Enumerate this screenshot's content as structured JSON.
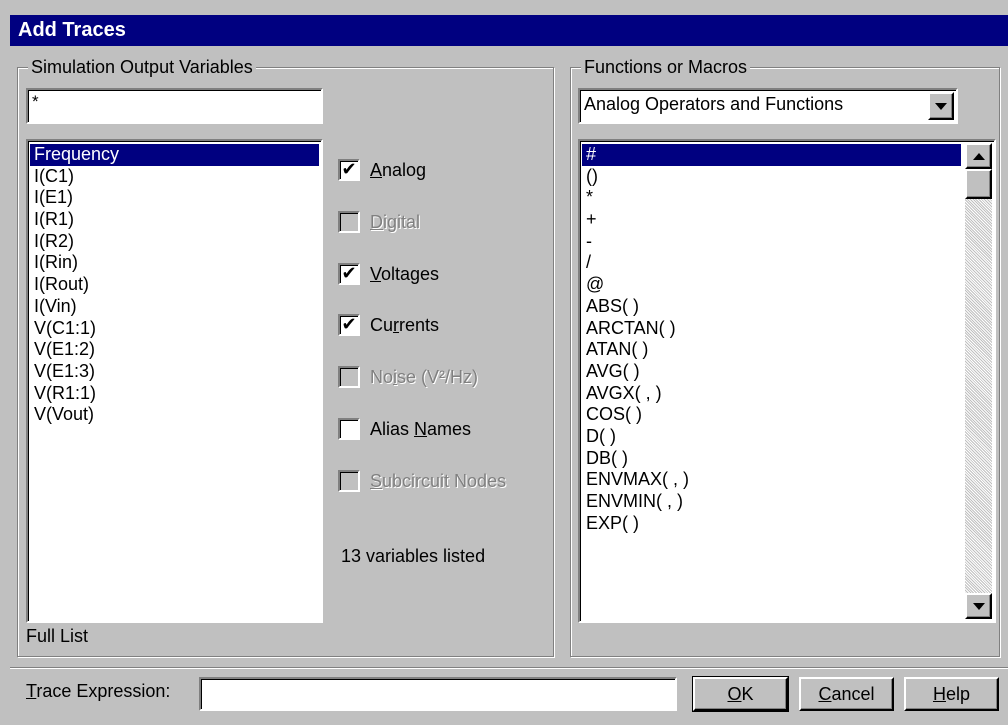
{
  "dialog": {
    "title": "Add Traces"
  },
  "left_group": {
    "title": "Simulation Output Variables",
    "filter_value": "*",
    "variables": [
      "Frequency",
      "I(C1)",
      "I(E1)",
      "I(R1)",
      "I(R2)",
      "I(Rin)",
      "I(Rout)",
      "I(Vin)",
      "V(C1:1)",
      "V(E1:2)",
      "V(E1:3)",
      "V(R1:1)",
      "V(Vout)"
    ],
    "selected_variable": "Frequency",
    "list_label": "Full List",
    "count_text": "13 variables listed"
  },
  "filters": [
    {
      "key": "analog",
      "pre": "",
      "hot": "A",
      "post": "nalog",
      "checked": true,
      "enabled": true
    },
    {
      "key": "digital",
      "pre": "",
      "hot": "D",
      "post": "igital",
      "checked": false,
      "enabled": false
    },
    {
      "key": "voltages",
      "pre": "",
      "hot": "V",
      "post": "oltages",
      "checked": true,
      "enabled": true
    },
    {
      "key": "currents",
      "pre": "Cu",
      "hot": "r",
      "post": "rents",
      "checked": true,
      "enabled": true
    },
    {
      "key": "noise",
      "pre": "No",
      "hot": "i",
      "post": "se (V²/Hz)",
      "checked": false,
      "enabled": false
    },
    {
      "key": "alias-names",
      "pre": "Alias ",
      "hot": "N",
      "post": "ames",
      "checked": false,
      "enabled": true
    },
    {
      "key": "subcircuit-nodes",
      "pre": "",
      "hot": "S",
      "post": "ubcircuit Nodes",
      "checked": false,
      "enabled": false
    }
  ],
  "right_group": {
    "title": "Functions or Macros",
    "dropdown_value": "Analog Operators and Functions",
    "functions": [
      "#",
      "()",
      "*",
      "+",
      "-",
      "/",
      "@",
      "ABS( )",
      "ARCTAN( )",
      "ATAN( )",
      "AVG( )",
      "AVGX( , )",
      "COS( )",
      "D( )",
      "DB( )",
      "ENVMAX( , )",
      "ENVMIN( , )",
      "EXP( )"
    ],
    "selected_function": "#"
  },
  "trace": {
    "label_hot": "T",
    "label_rest": "race Expression:",
    "value": ""
  },
  "buttons": {
    "ok": {
      "hot": "O",
      "rest": "K"
    },
    "cancel": {
      "hot": "C",
      "rest": "ancel"
    },
    "help": {
      "hot": "H",
      "rest": "elp"
    }
  },
  "colors": {
    "titlebar": "#000080",
    "face": "#c0c0c0",
    "selection": "#000080",
    "disabled_text": "#808080"
  }
}
